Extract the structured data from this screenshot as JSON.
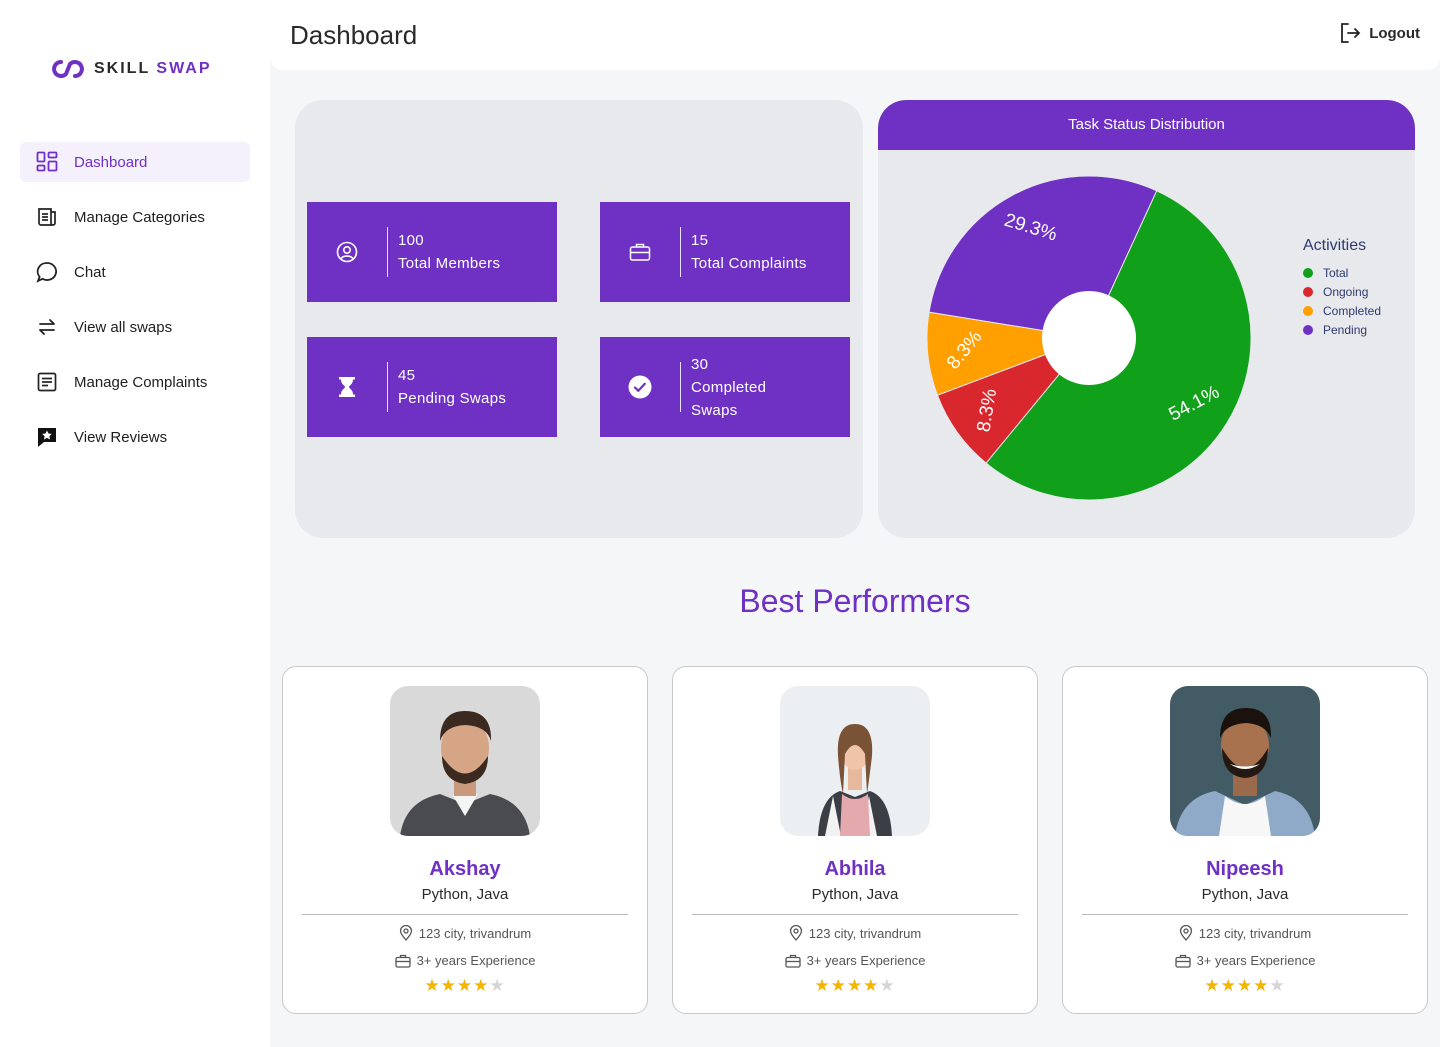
{
  "app": {
    "logo_part1": "SKILL",
    "logo_part2": "SWAP",
    "accent_color": "#6f31c4"
  },
  "sidebar": {
    "items": [
      {
        "label": "Dashboard",
        "icon": "dashboard-grid-icon",
        "active": true
      },
      {
        "label": "Manage Categories",
        "icon": "scroll-list-icon"
      },
      {
        "label": "Chat",
        "icon": "chat-bubble-icon"
      },
      {
        "label": "View all swaps",
        "icon": "swap-arrows-icon"
      },
      {
        "label": "Manage Complaints",
        "icon": "document-list-icon"
      },
      {
        "label": "View Reviews",
        "icon": "star-review-icon"
      }
    ]
  },
  "header": {
    "title": "Dashboard",
    "logout_label": "Logout"
  },
  "stats": [
    {
      "value": "100",
      "label": "Total Members",
      "icon": "user-circle-icon"
    },
    {
      "value": "15",
      "label": "Total Complaints",
      "icon": "briefcase-icon"
    },
    {
      "value": "45",
      "label": "Pending Swaps",
      "icon": "hourglass-icon"
    },
    {
      "value": "30",
      "label_line1": "Completed",
      "label_line2": "Swaps",
      "icon": "check-circle-icon"
    }
  ],
  "chart_data": {
    "type": "pie",
    "title": "Task Status Distribution",
    "legend_title": "Activities",
    "legend_position": "right",
    "categories": [
      "Total",
      "Ongoing",
      "Completed",
      "Pending"
    ],
    "values": [
      54.1,
      8.3,
      8.3,
      29.3
    ],
    "labels": [
      "54.1%",
      "8.3%",
      "8.3%",
      "29.3%"
    ],
    "colors": [
      "#10a01a",
      "#d9272e",
      "#ff9f00",
      "#6f31c4"
    ],
    "donut": true
  },
  "best_performers": {
    "title": "Best Performers",
    "people": [
      {
        "name": "Akshay",
        "skills": "Python, Java",
        "location": "123 city, trivandrum",
        "experience": "3+ years Experience",
        "rating": 4,
        "rating_max": 5
      },
      {
        "name": "Abhila",
        "skills": "Python, Java",
        "location": "123 city, trivandrum",
        "experience": "3+ years Experience",
        "rating": 4,
        "rating_max": 5
      },
      {
        "name": "Nipeesh",
        "skills": "Python, Java",
        "location": "123 city, trivandrum",
        "experience": "3+ years Experience",
        "rating": 4,
        "rating_max": 5
      }
    ]
  }
}
